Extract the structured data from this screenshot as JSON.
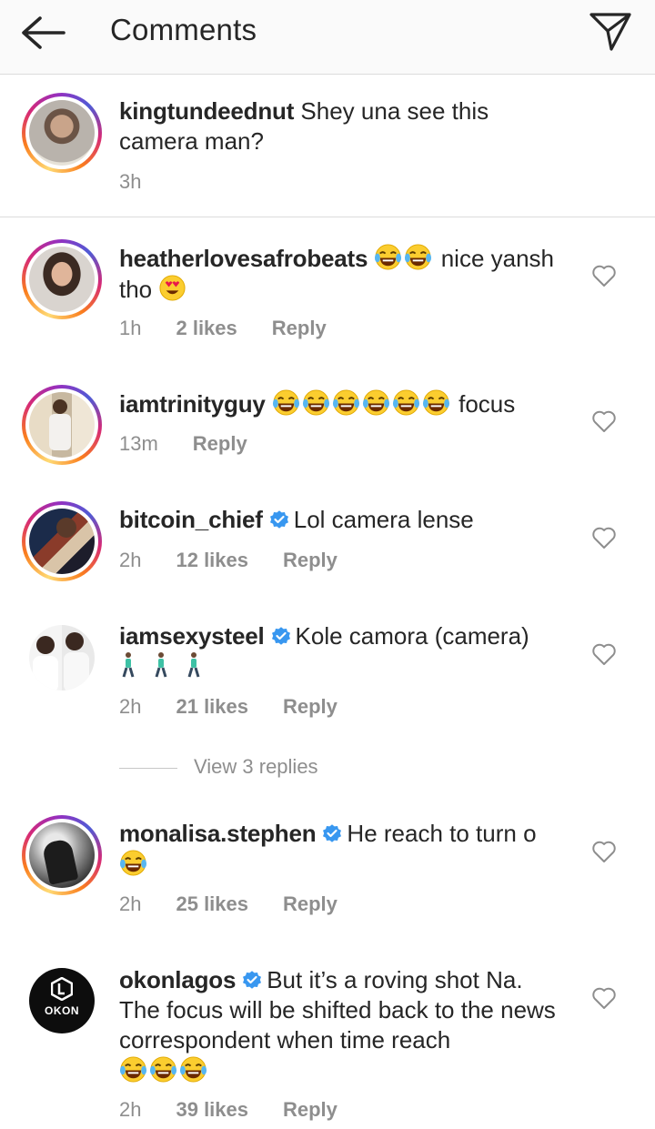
{
  "header": {
    "title": "Comments",
    "back_icon": "arrow-left-icon",
    "send_icon": "paper-plane-icon"
  },
  "caption": {
    "username": "kingtundeednut",
    "text": " Shey una see this camera man?",
    "time": "3h"
  },
  "comments": [
    {
      "username": "heatherlovesafrobeats",
      "text_before": "",
      "text_after": " nice yansh tho",
      "time": "1h",
      "likes": "2 likes",
      "reply": "Reply"
    },
    {
      "username": "iamtrinityguy",
      "text_after": " focus",
      "time": "13m",
      "reply": "Reply"
    },
    {
      "username": "bitcoin_chief",
      "text": "Lol camera lense",
      "time": "2h",
      "likes": "12 likes",
      "reply": "Reply"
    },
    {
      "username": "iamsexysteel",
      "text": "Kole camora (camera)",
      "time": "2h",
      "likes": "21 likes",
      "reply": "Reply"
    },
    {
      "username": "monalisa.stephen",
      "text": "He reach to turn o",
      "time": "2h",
      "likes": "25 likes",
      "reply": "Reply"
    },
    {
      "username": "okonlagos",
      "text": "But it’s a roving shot Na. The focus will be shifted back to the news correspondent when time reach",
      "time": "2h",
      "likes": "39 likes",
      "reply": "Reply"
    }
  ],
  "view_replies": "View 3 replies",
  "okon_logo": "OKON",
  "colors": {
    "text": "#262626",
    "muted": "#8e8e8e",
    "verified": "#3897f0",
    "divider": "#dbdbdb"
  }
}
